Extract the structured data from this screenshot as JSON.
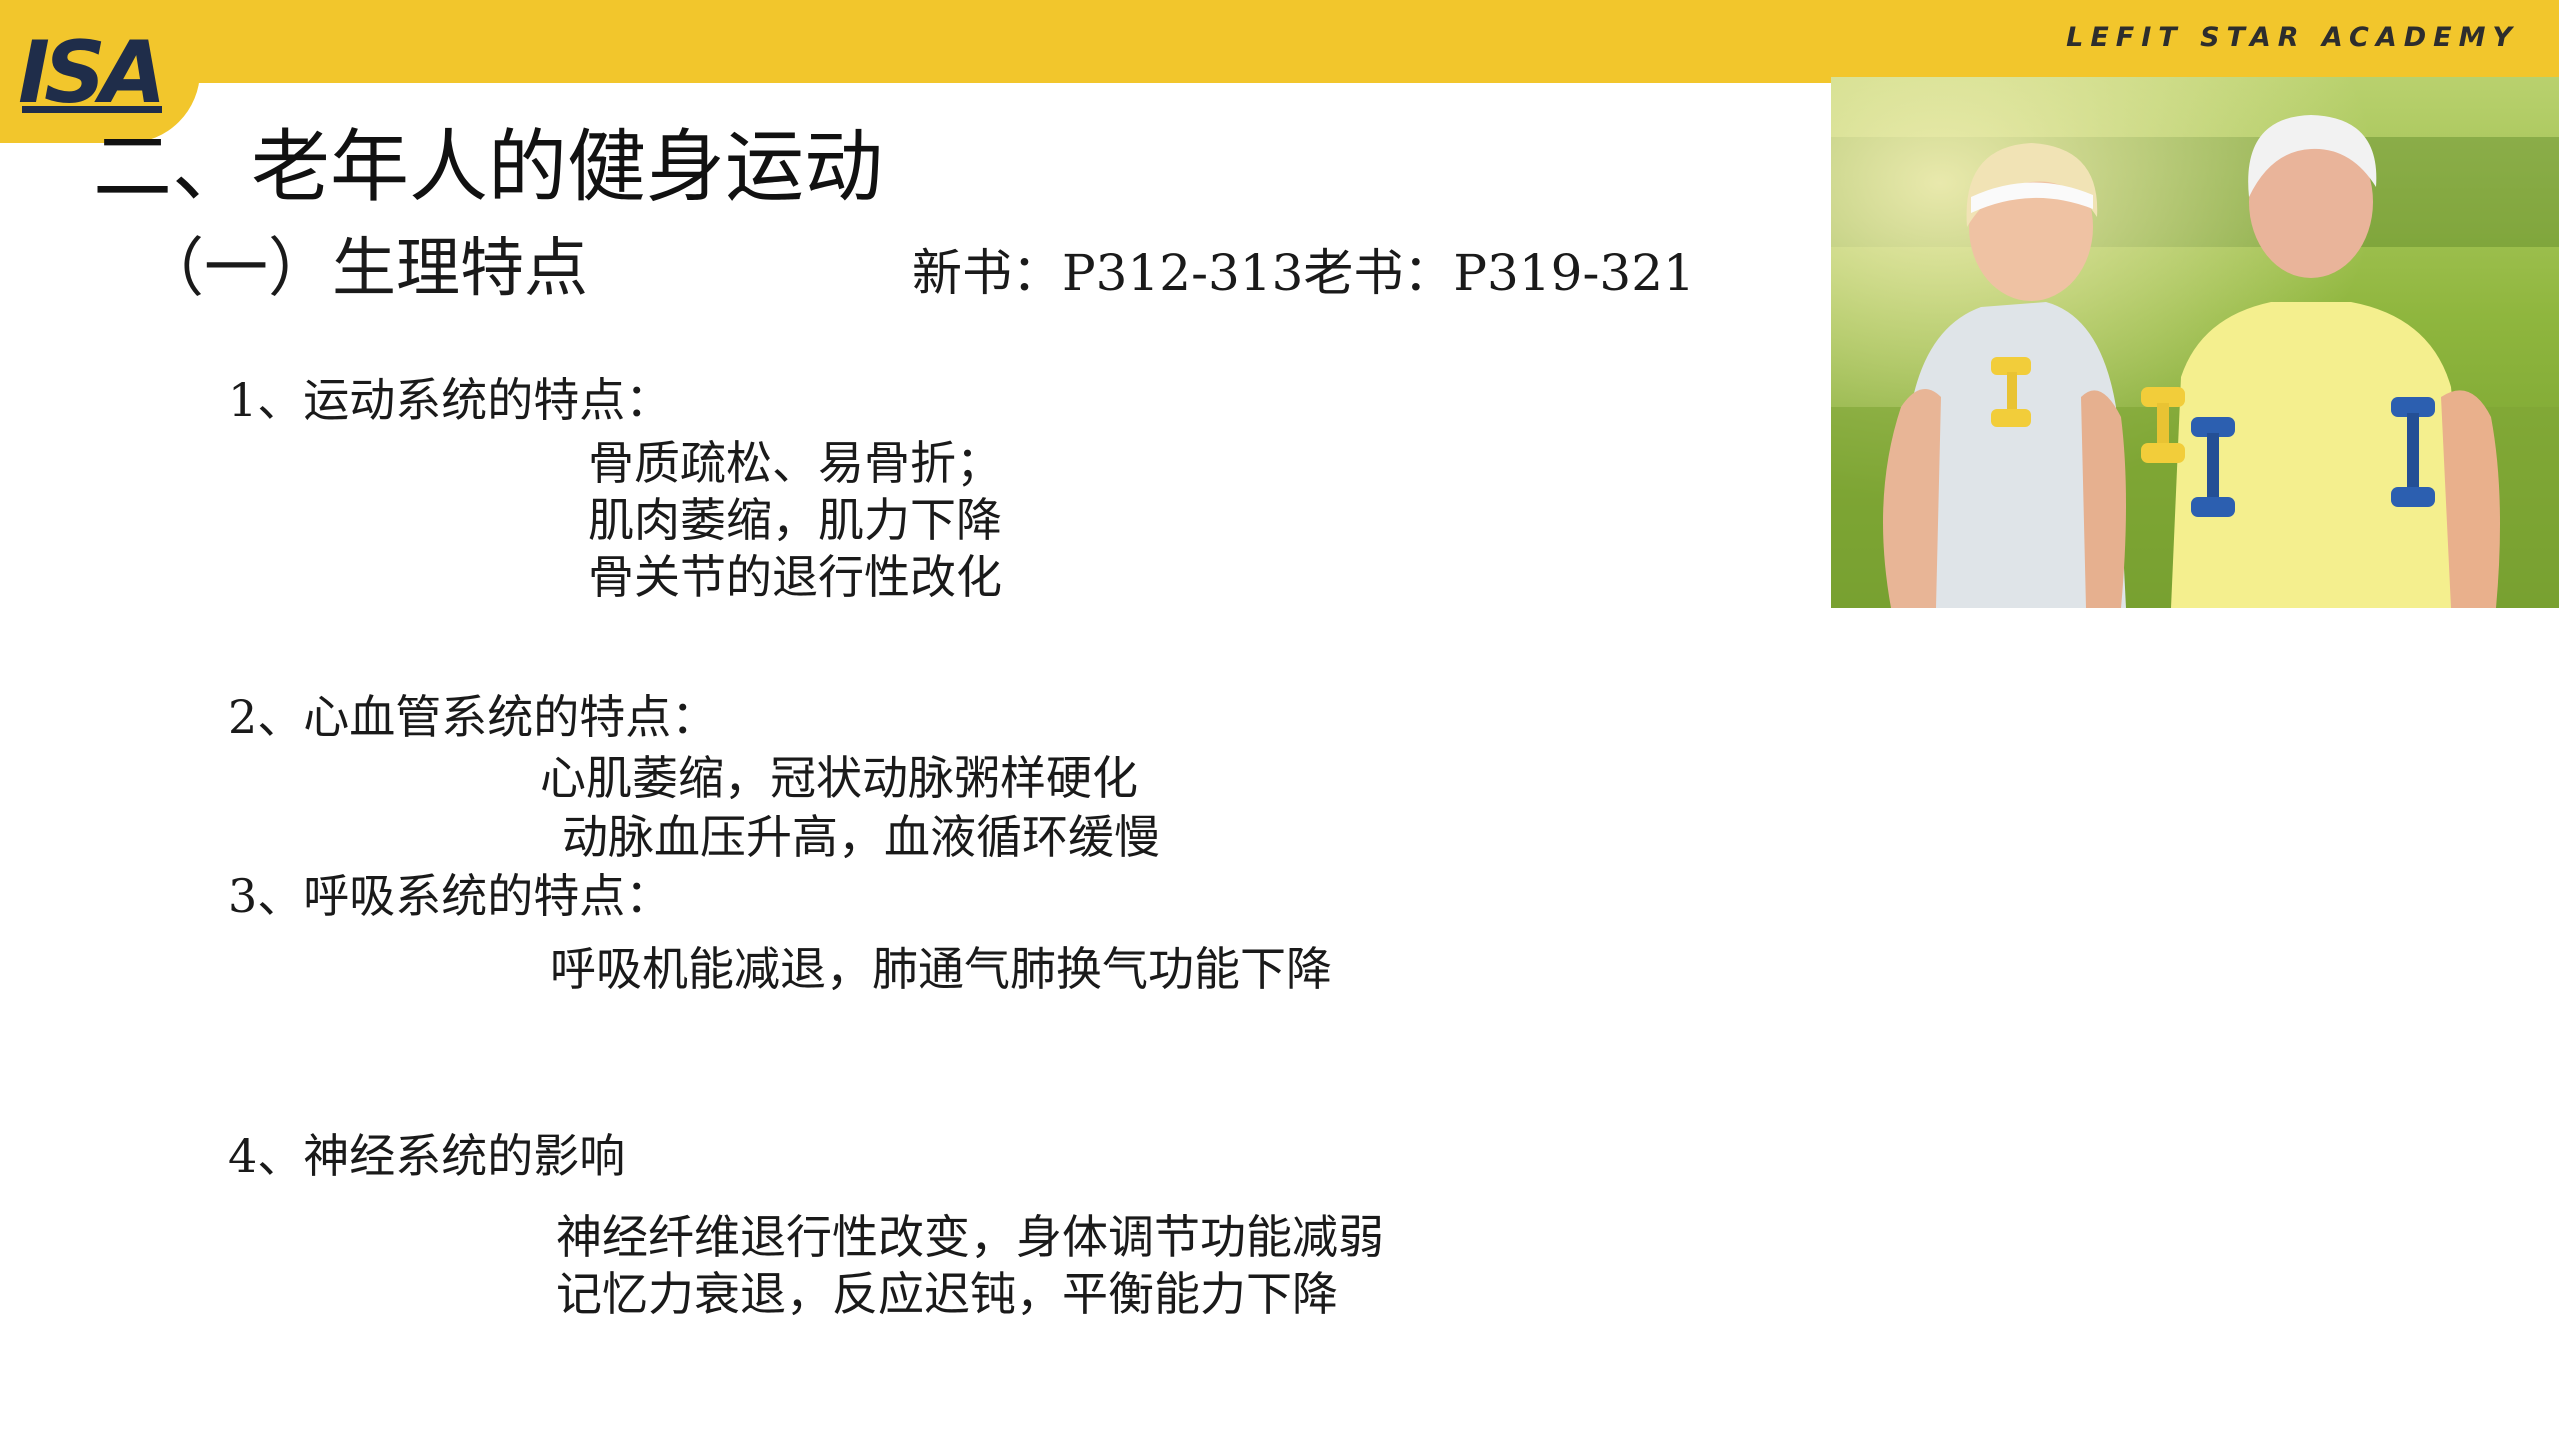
{
  "header": {
    "logo_text": "ISA",
    "brand": "LEFIT STAR ACADEMY",
    "accent_color": "#f2c62c"
  },
  "slide": {
    "title": "二、老年人的健身运动",
    "subtitle": "（一）生理特点",
    "reference": "新书：P312-313老书：P319-321"
  },
  "sections": [
    {
      "heading": "1、运动系统的特点：",
      "lines": [
        "骨质疏松、易骨折；",
        "肌肉萎缩，肌力下降",
        "骨关节的退行性改化"
      ]
    },
    {
      "heading": "2、心血管系统的特点：",
      "lines": [
        "心肌萎缩，冠状动脉粥样硬化",
        "动脉血压升高，血液循环缓慢"
      ]
    },
    {
      "heading": "3、呼吸系统的特点：",
      "lines": [
        "呼吸机能减退，肺通气肺换气功能下降"
      ]
    },
    {
      "heading": "4、神经系统的影响",
      "lines": [
        "神经纤维退行性改变，身体调节功能减弱",
        "记忆力衰退，反应迟钝，平衡能力下降"
      ]
    }
  ]
}
